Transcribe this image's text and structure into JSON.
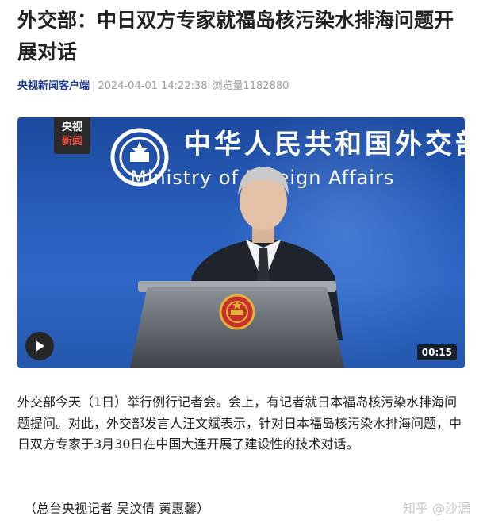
{
  "article": {
    "title": "外交部：中日双方专家就福岛核污染水排海问题开展对话",
    "source": "央视新闻客户端",
    "separator": "|",
    "published": "2024-04-01 14:22:38",
    "views": "浏览量1182880",
    "body": "外交部今天（1日）举行例行记者会。会上，有记者就日本福岛核污染水排海问题提问。对此，外交部发言人汪文斌表示，针对日本福岛核污染水排海问题，中日双方专家于3月30日在中国大连开展了建设性的技术对话。",
    "credit": "（总台央视记者 吴汶倩 黄惠馨）"
  },
  "video": {
    "logo_line1": "央视",
    "logo_line2": "新闻",
    "backdrop_cn": "中华人民共和国外交部",
    "backdrop_en": "Ministry of Foreign Affairs",
    "duration": "00:15",
    "play_icon": "play-icon"
  },
  "watermark": "知乎 @沙漏",
  "colors": {
    "source_link": "#1a3a8c",
    "backdrop_blue": "#2a60c0",
    "logo_red": "#e64a3a"
  }
}
